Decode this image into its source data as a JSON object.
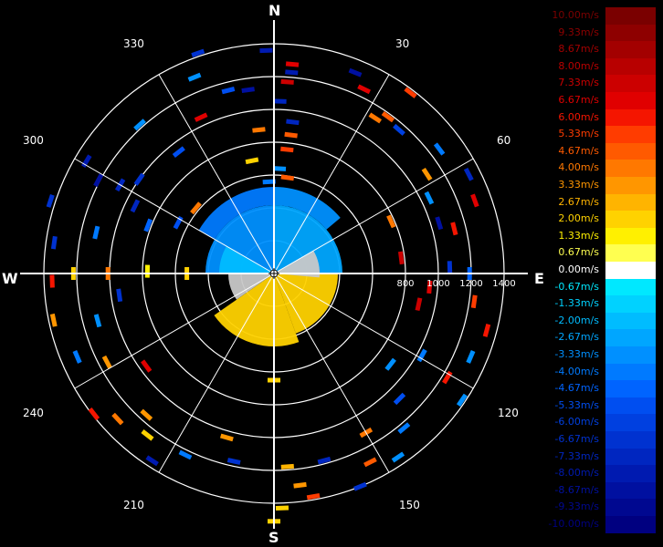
{
  "compass": {
    "north": "N",
    "east": "E",
    "south": "S",
    "west": "W"
  },
  "bearing_labels": [
    "30",
    "60",
    "120",
    "150",
    "210",
    "240",
    "300",
    "330"
  ],
  "chart_data": {
    "type": "polar radar velocity plot (PPI)",
    "title": "",
    "range_tick_labels": [
      "800",
      "1000",
      "1200",
      "1400"
    ],
    "range_rings": [
      200,
      400,
      600,
      800,
      1000,
      1200,
      1400
    ],
    "spokes_deg": [
      0,
      30,
      60,
      90,
      120,
      150,
      180,
      210,
      240,
      270,
      300,
      330
    ],
    "colorbar": {
      "unit": "m/s",
      "labels": [
        "10.00m/s",
        "9.33m/s",
        "8.67m/s",
        "8.00m/s",
        "7.33m/s",
        "6.67m/s",
        "6.00m/s",
        "5.33m/s",
        "4.67m/s",
        "4.00m/s",
        "3.33m/s",
        "2.67m/s",
        "2.00m/s",
        "1.33m/s",
        "0.67m/s",
        "0.00m/s",
        "-0.67m/s",
        "-1.33m/s",
        "-2.00m/s",
        "-2.67m/s",
        "-3.33m/s",
        "-4.00m/s",
        "-4.67m/s",
        "-5.33m/s",
        "-6.00m/s",
        "-6.67m/s",
        "-7.33m/s",
        "-8.00m/s",
        "-8.67m/s",
        "-9.33m/s",
        "-10.00m/s"
      ],
      "colors": [
        "#7a0000",
        "#8e0000",
        "#a30000",
        "#b80000",
        "#cc0000",
        "#e00000",
        "#f51500",
        "#ff3c00",
        "#ff5a00",
        "#ff7800",
        "#ff9600",
        "#ffb400",
        "#ffd200",
        "#fff000",
        "#ffff50",
        "#ffffff",
        "#00e8ff",
        "#00d2ff",
        "#00bcff",
        "#00a6ff",
        "#0090ff",
        "#007aff",
        "#0064ff",
        "#004ef0",
        "#0040e0",
        "#0032d0",
        "#0026c0",
        "#001ab0",
        "#0010a0",
        "#000890",
        "#000080"
      ]
    },
    "near_field": {
      "description_free": true,
      "rings": [
        {
          "r_max": 230,
          "sectors": [
            [
              300,
              330,
              -3.33
            ],
            [
              330,
              360,
              -2.67
            ],
            [
              0,
              30,
              -3.33
            ],
            [
              30,
              60,
              -4.0
            ],
            [
              60,
              80,
              1.33
            ]
          ]
        }
      ]
    },
    "bins": [
      {
        "az": 2,
        "r": 1050,
        "v": -7.33
      },
      {
        "az": 4,
        "r": 1170,
        "v": 7.33
      },
      {
        "az": 5,
        "r": 1230,
        "v": -8.0
      },
      {
        "az": 5,
        "r": 1280,
        "v": 6.67
      },
      {
        "az": 7,
        "r": 930,
        "v": -7.33
      },
      {
        "az": 7,
        "r": 850,
        "v": 4.67
      },
      {
        "az": 6,
        "r": 760,
        "v": 5.33
      },
      {
        "az": 3,
        "r": 640,
        "v": -3.33
      },
      {
        "az": 8,
        "r": 590,
        "v": 4.67
      },
      {
        "az": 22,
        "r": 1320,
        "v": -8.67
      },
      {
        "az": 26,
        "r": 1250,
        "v": 6.67
      },
      {
        "az": 33,
        "r": 1130,
        "v": 4.0
      },
      {
        "az": 36,
        "r": 1180,
        "v": 4.67
      },
      {
        "az": 37,
        "r": 1380,
        "v": 5.33
      },
      {
        "az": 41,
        "r": 1160,
        "v": -6.0
      },
      {
        "az": 53,
        "r": 1260,
        "v": -4.0
      },
      {
        "az": 57,
        "r": 1110,
        "v": 3.33
      },
      {
        "az": 64,
        "r": 1050,
        "v": -3.33
      },
      {
        "az": 63,
        "r": 1330,
        "v": -7.33
      },
      {
        "az": 66,
        "r": 780,
        "v": 4.0
      },
      {
        "az": 73,
        "r": 1050,
        "v": -8.67
      },
      {
        "az": 76,
        "r": 1130,
        "v": 6.0
      },
      {
        "az": 70,
        "r": 1300,
        "v": 6.67
      },
      {
        "az": 83,
        "r": 780,
        "v": 7.33
      },
      {
        "az": 88,
        "r": 1070,
        "v": -6.67
      },
      {
        "az": 90,
        "r": 1190,
        "v": -4.67
      },
      {
        "az": 95,
        "r": 950,
        "v": 6.67
      },
      {
        "az": 98,
        "r": 1230,
        "v": 5.33
      },
      {
        "az": 102,
        "r": 900,
        "v": 7.33
      },
      {
        "az": 105,
        "r": 1340,
        "v": 6.0
      },
      {
        "az": 113,
        "r": 1300,
        "v": -3.33
      },
      {
        "az": 119,
        "r": 1030,
        "v": -4.0
      },
      {
        "az": 121,
        "r": 1230,
        "v": 6.0
      },
      {
        "az": 124,
        "r": 1380,
        "v": -3.33
      },
      {
        "az": 128,
        "r": 900,
        "v": -3.33
      },
      {
        "az": 135,
        "r": 1080,
        "v": -5.33
      },
      {
        "az": 140,
        "r": 1230,
        "v": -4.0
      },
      {
        "az": 146,
        "r": 1350,
        "v": -3.33
      },
      {
        "az": 150,
        "r": 1120,
        "v": 4.0
      },
      {
        "az": 153,
        "r": 1290,
        "v": 4.67
      },
      {
        "az": 158,
        "r": 1400,
        "v": -6.67
      },
      {
        "az": 165,
        "r": 1180,
        "v": -7.33
      },
      {
        "az": 170,
        "r": 1380,
        "v": 5.33
      },
      {
        "az": 173,
        "r": 1300,
        "v": 3.33
      },
      {
        "az": 176,
        "r": 1180,
        "v": 2.67
      },
      {
        "az": 178,
        "r": 1430,
        "v": 2.0
      },
      {
        "az": 180,
        "r": 1510,
        "v": 2.0
      },
      {
        "az": 180,
        "r": 650,
        "v": 2.0
      },
      {
        "az": 192,
        "r": 1170,
        "v": -6.67
      },
      {
        "az": 196,
        "r": 1040,
        "v": 3.33
      },
      {
        "az": 206,
        "r": 1230,
        "v": -4.0
      },
      {
        "az": 213,
        "r": 1360,
        "v": -8.0
      },
      {
        "az": 218,
        "r": 1250,
        "v": 2.0
      },
      {
        "az": 222,
        "r": 1160,
        "v": 3.33
      },
      {
        "az": 227,
        "r": 1300,
        "v": 4.0
      },
      {
        "az": 232,
        "r": 1390,
        "v": 6.0
      },
      {
        "az": 234,
        "r": 960,
        "v": 6.67
      },
      {
        "az": 242,
        "r": 1150,
        "v": 3.33
      },
      {
        "az": 247,
        "r": 1300,
        "v": -4.0
      },
      {
        "az": 255,
        "r": 1110,
        "v": -3.33
      },
      {
        "az": 258,
        "r": 1370,
        "v": 3.33
      },
      {
        "az": 262,
        "r": 950,
        "v": -6.67
      },
      {
        "az": 268,
        "r": 1350,
        "v": 6.0
      },
      {
        "az": 270,
        "r": 1010,
        "v": 4.0
      },
      {
        "az": 270,
        "r": 1220,
        "v": 2.0
      },
      {
        "az": 271,
        "r": 770,
        "v": 1.33
      },
      {
        "az": 270,
        "r": 530,
        "v": 2.0
      },
      {
        "az": 278,
        "r": 1350,
        "v": -6.67
      },
      {
        "az": 283,
        "r": 1110,
        "v": -4.0
      },
      {
        "az": 288,
        "r": 1430,
        "v": -6.67
      },
      {
        "az": 291,
        "r": 820,
        "v": -4.67
      },
      {
        "az": 296,
        "r": 940,
        "v": -7.33
      },
      {
        "az": 298,
        "r": 1210,
        "v": -8.67
      },
      {
        "az": 298,
        "r": 660,
        "v": -5.33
      },
      {
        "az": 300,
        "r": 1080,
        "v": -7.33
      },
      {
        "az": 301,
        "r": 1330,
        "v": -8.0
      },
      {
        "az": 305,
        "r": 1000,
        "v": -6.67
      },
      {
        "az": 310,
        "r": 620,
        "v": 4.0
      },
      {
        "az": 318,
        "r": 1220,
        "v": -3.33
      },
      {
        "az": 322,
        "r": 940,
        "v": -5.33
      },
      {
        "az": 335,
        "r": 1050,
        "v": 6.67
      },
      {
        "az": 338,
        "r": 1290,
        "v": -3.33
      },
      {
        "az": 341,
        "r": 1420,
        "v": -6.67
      },
      {
        "az": 346,
        "r": 1150,
        "v": -5.33
      },
      {
        "az": 349,
        "r": 700,
        "v": 2.0
      },
      {
        "az": 352,
        "r": 1130,
        "v": -8.67
      },
      {
        "az": 354,
        "r": 880,
        "v": 4.0
      },
      {
        "az": 357,
        "r": 560,
        "v": -4.0
      },
      {
        "az": 358,
        "r": 1360,
        "v": -8.0
      }
    ]
  }
}
